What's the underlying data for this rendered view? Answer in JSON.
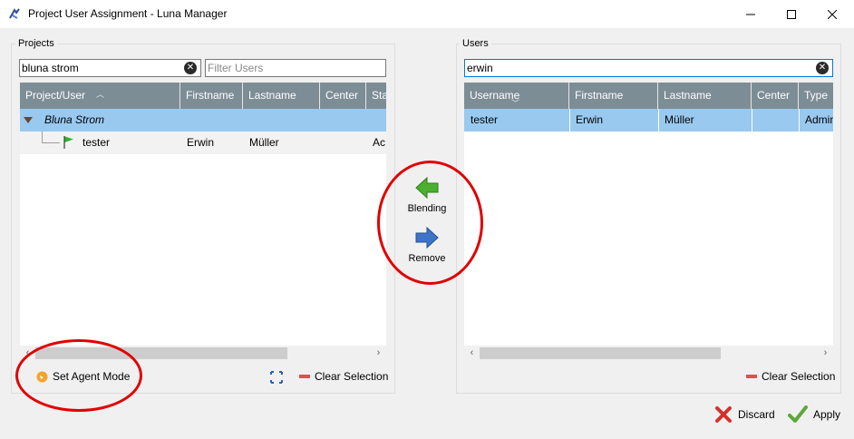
{
  "window": {
    "title": "Project User Assignment - Luna Manager",
    "controls": {
      "minimize": "—",
      "maximize": "☐",
      "close": "✕"
    }
  },
  "projects": {
    "label": "Projects",
    "search_value": "bluna strom",
    "filter_placeholder": "Filter Users",
    "columns": [
      "Project/User",
      "Firstname",
      "Lastname",
      "Center",
      "Sta"
    ],
    "group_row": {
      "name": "Bluna Strom"
    },
    "user_row": {
      "user": "tester",
      "firstname": "Erwin",
      "lastname": "Müller",
      "center": "",
      "status": "Ac"
    },
    "set_agent_mode": "Set Agent Mode",
    "clear_selection": "Clear Selection"
  },
  "middle": {
    "add_label": "Blending",
    "remove_label": "Remove"
  },
  "users": {
    "label": "Users",
    "search_value": "erwin",
    "columns": [
      "Username",
      "Firstname",
      "Lastname",
      "Center",
      "Type"
    ],
    "rows": [
      {
        "username": "tester",
        "firstname": "Erwin",
        "lastname": "Müller",
        "center": "",
        "type": "Admin"
      }
    ],
    "clear_selection": "Clear Selection"
  },
  "footer": {
    "discard": "Discard",
    "apply": "Apply"
  },
  "colors": {
    "header_bg": "#7d8d96",
    "selection": "#99c9ef",
    "annotation": "#e00000"
  }
}
